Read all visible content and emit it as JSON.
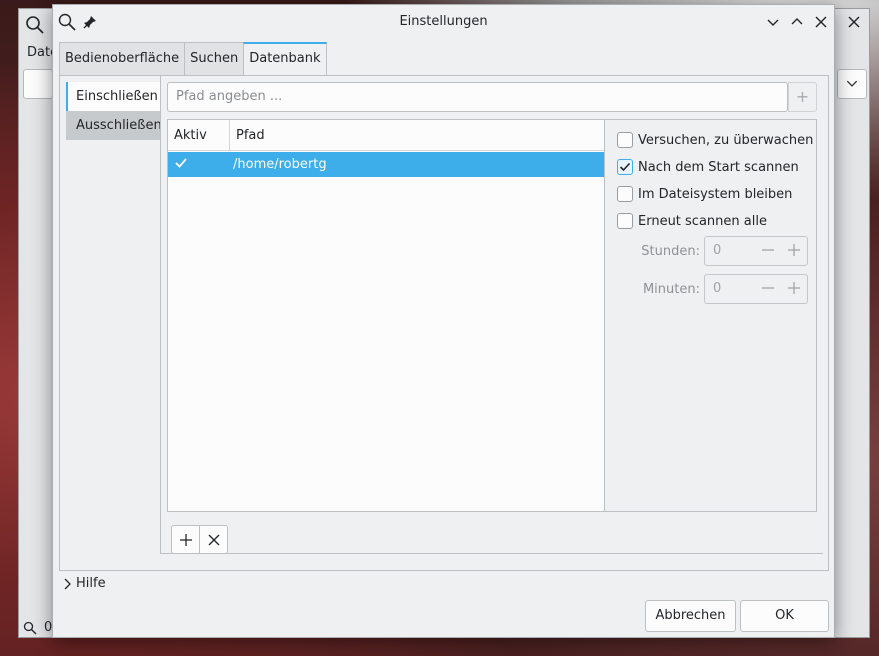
{
  "window": {
    "title": "Einstellungen"
  },
  "parent": {
    "label_partial": "Date",
    "status_partial": "0"
  },
  "tabs": [
    {
      "label": "Bedienoberfläche",
      "active": false
    },
    {
      "label": "Suchen",
      "active": false
    },
    {
      "label": "Datenbank",
      "active": true
    }
  ],
  "side_tabs": [
    {
      "label": "Einschließen",
      "active": true
    },
    {
      "label": "Ausschließen",
      "active": false
    }
  ],
  "path_input": {
    "placeholder": "Pfad angeben ...",
    "add_label": "+"
  },
  "table": {
    "columns": [
      "Aktiv",
      "Pfad"
    ],
    "rows": [
      {
        "active": true,
        "path": "/home/robertg",
        "selected": true
      }
    ]
  },
  "options": {
    "try_watch": {
      "label": "Versuchen, zu überwachen",
      "checked": false
    },
    "scan_on_start": {
      "label": "Nach dem Start scannen",
      "checked": true
    },
    "stay_on_fs": {
      "label": "Im Dateisystem bleiben",
      "checked": false
    },
    "rescan_all": {
      "label": "Erneut scannen alle",
      "checked": false
    },
    "hours": {
      "label": "Stunden:",
      "value": "0"
    },
    "minutes": {
      "label": "Minuten:",
      "value": "0"
    }
  },
  "help": {
    "label": "Hilfe"
  },
  "buttons": {
    "cancel": "Abbrechen",
    "ok": "OK"
  },
  "colors": {
    "accent": "#3daee9",
    "window_bg": "#eff0f1",
    "text": "#232629"
  },
  "icons": [
    "search-icon",
    "pin-icon",
    "minimize-icon",
    "maximize-icon",
    "close-icon",
    "check-icon",
    "add-icon",
    "remove-icon",
    "minus-icon",
    "plus-icon",
    "chevron-right-icon"
  ]
}
